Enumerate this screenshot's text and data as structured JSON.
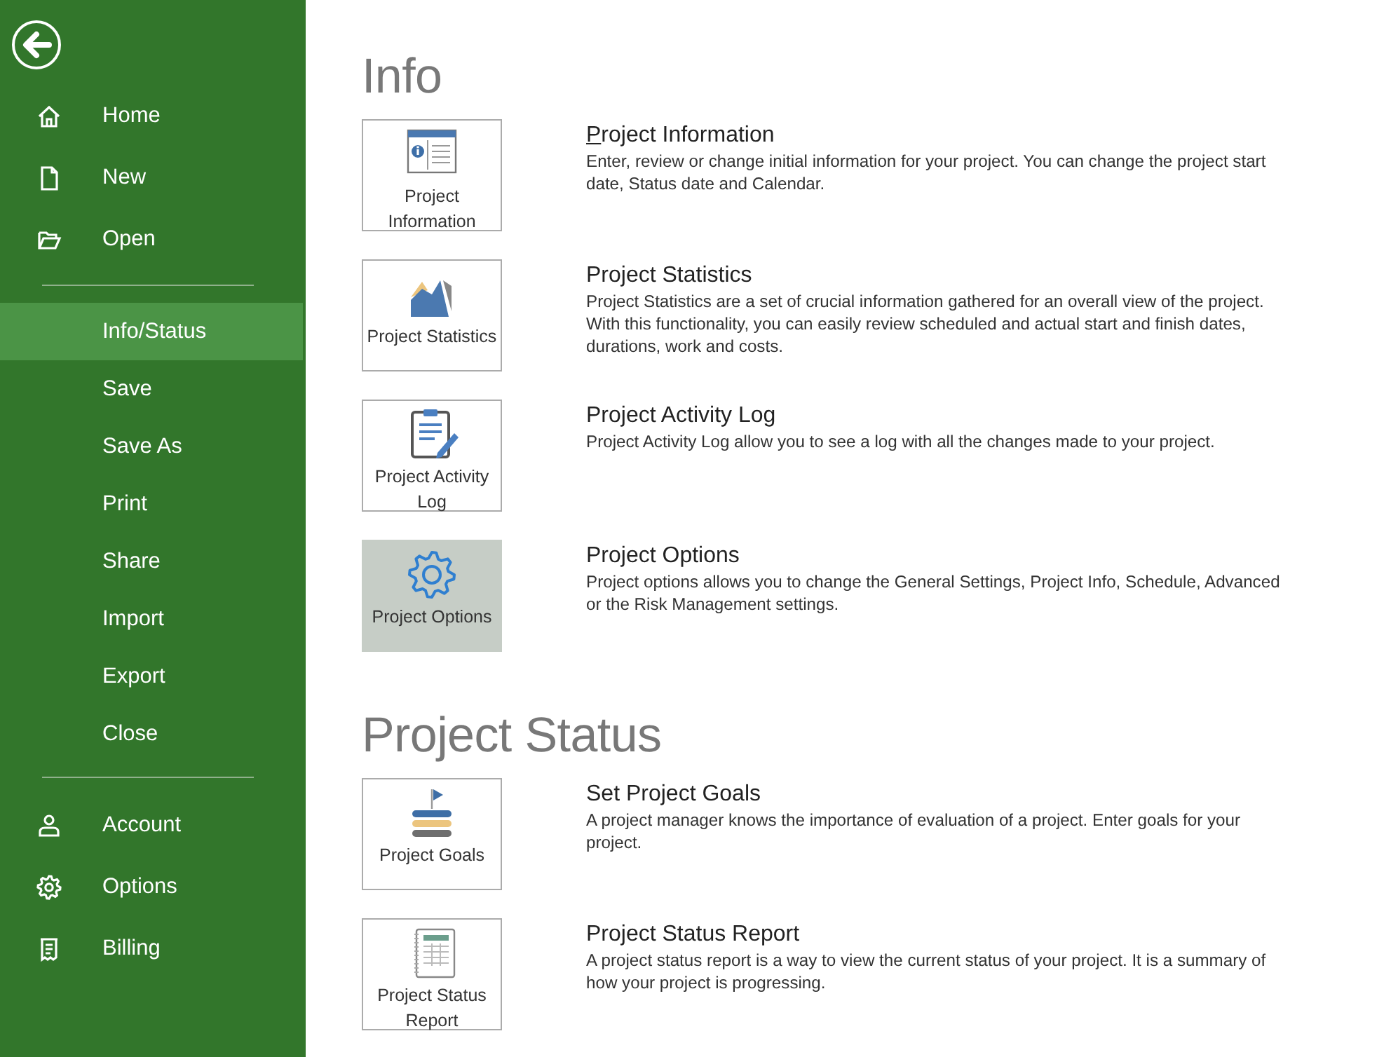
{
  "sidebar": {
    "groups": [
      [
        {
          "label": "Home",
          "selected": false
        },
        {
          "label": "New",
          "selected": false
        },
        {
          "label": "Open",
          "selected": false
        }
      ],
      [
        {
          "label": "Info/Status",
          "selected": true
        },
        {
          "label": "Save",
          "selected": false
        },
        {
          "label": "Save As",
          "selected": false
        },
        {
          "label": "Print",
          "selected": false
        },
        {
          "label": "Share",
          "selected": false
        },
        {
          "label": "Import",
          "selected": false
        },
        {
          "label": "Export",
          "selected": false
        },
        {
          "label": "Close",
          "selected": false
        }
      ],
      [
        {
          "label": "Account",
          "selected": false
        },
        {
          "label": "Options",
          "selected": false
        },
        {
          "label": "Billing",
          "selected": false
        }
      ]
    ]
  },
  "sections": [
    {
      "title": "Info",
      "cards": [
        {
          "tile_label": "Project Information",
          "title": "Project Information",
          "access_key_underlined": true,
          "highlighted": false,
          "description": "Enter, review or change initial information for your project. You can change the project start date, Status date and Calendar."
        },
        {
          "tile_label": "Project Statistics",
          "title": "Project Statistics",
          "access_key_underlined": false,
          "highlighted": false,
          "description": "Project Statistics are a set of crucial information gathered for an overall view of the project. With this functionality, you can easily review scheduled and actual start and finish dates, durations, work and costs."
        },
        {
          "tile_label": "Project Activity Log",
          "title": "Project Activity Log",
          "access_key_underlined": false,
          "highlighted": false,
          "description": "Project Activity Log allow you to see a log with all the changes made to your project."
        },
        {
          "tile_label": "Project Options",
          "title": "Project Options",
          "access_key_underlined": false,
          "highlighted": true,
          "description": "Project options allows you to change the General Settings, Project Info, Schedule, Advanced or the Risk Management settings."
        }
      ]
    },
    {
      "title": "Project Status",
      "cards": [
        {
          "tile_label": "Project Goals",
          "title": "Set Project Goals",
          "access_key_underlined": false,
          "highlighted": false,
          "description": "A project manager knows the importance of evaluation of a project. Enter goals for your project."
        },
        {
          "tile_label": "Project Status Report",
          "title": "Project Status Report",
          "access_key_underlined": false,
          "highlighted": false,
          "description": "A project status report is a way to view the current status of your project. It is a summary of how your project is progressing."
        }
      ]
    }
  ]
}
